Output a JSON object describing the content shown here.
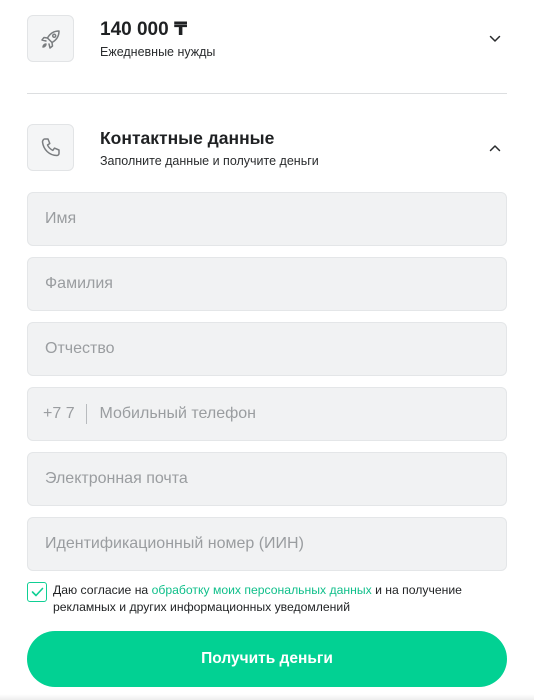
{
  "loan_section": {
    "amount": "140 000 ₸",
    "purpose": "Ежедневные нужды",
    "icon": "rocket-icon"
  },
  "contact_section": {
    "title": "Контактные данные",
    "subtitle": "Заполните данные и получите деньги",
    "icon": "phone-icon"
  },
  "fields": {
    "first_name": {
      "placeholder": "Имя",
      "value": ""
    },
    "last_name": {
      "placeholder": "Фамилия",
      "value": ""
    },
    "middle_name": {
      "placeholder": "Отчество",
      "value": ""
    },
    "phone": {
      "prefix": "+7 7",
      "placeholder": "Мобильный телефон",
      "value": ""
    },
    "email": {
      "placeholder": "Электронная почта",
      "value": ""
    },
    "iin": {
      "placeholder": "Идентификационный номер (ИИН)",
      "value": ""
    }
  },
  "consent": {
    "checked": true,
    "text_before": "Даю согласие на ",
    "link_text": "обработку моих персональных данных",
    "text_after": " и на получение рекламных и других информационных уведомлений"
  },
  "submit_label": "Получить деньги",
  "colors": {
    "accent": "#02d193",
    "link": "#0fbf8a",
    "field_bg": "#f1f2f3"
  }
}
